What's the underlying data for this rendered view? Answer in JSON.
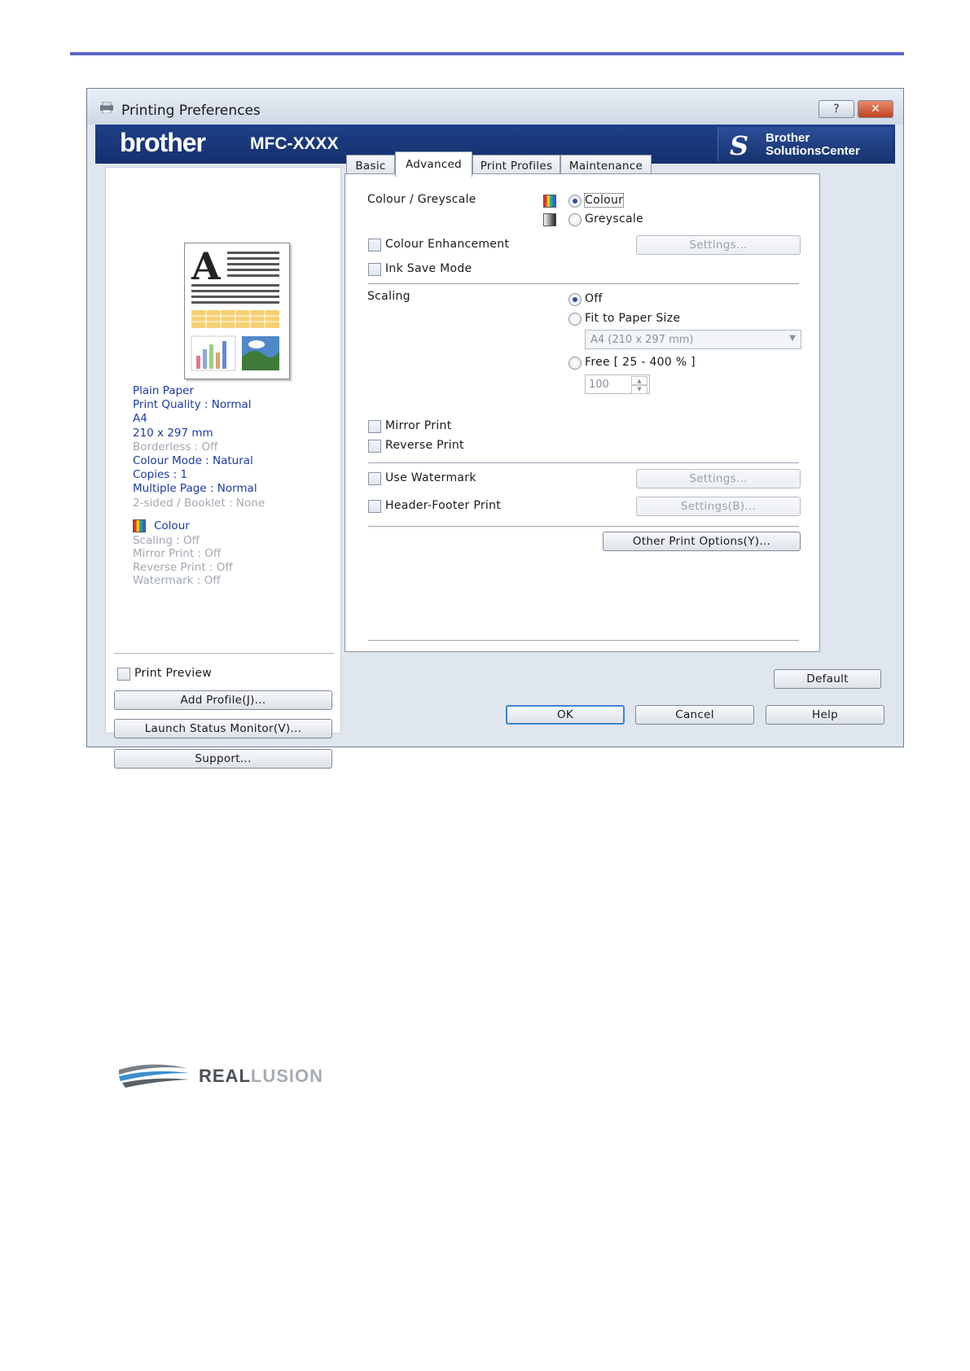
{
  "window": {
    "title": "Printing Preferences",
    "help_btn": "?",
    "close_btn": "✕"
  },
  "banner": {
    "brand": "brother",
    "model": "MFC-XXXX",
    "bsc_line1": "Brother",
    "bsc_line2": "SolutionsCenter"
  },
  "summary": {
    "items": [
      {
        "text": "Plain Paper",
        "enabled": true
      },
      {
        "text": "Print Quality : Normal",
        "enabled": true
      },
      {
        "text": "A4",
        "enabled": true
      },
      {
        "text": "210 x 297 mm",
        "enabled": true
      },
      {
        "text": "Borderless : Off",
        "enabled": false
      },
      {
        "text": "Colour Mode : Natural",
        "enabled": true
      },
      {
        "text": "Copies : 1",
        "enabled": true
      },
      {
        "text": "Multiple Page : Normal",
        "enabled": true
      },
      {
        "text": "2-sided / Booklet : None",
        "enabled": false
      }
    ],
    "colour_label": "Colour",
    "items2": [
      "Scaling : Off",
      "Mirror Print : Off",
      "Reverse Print : Off",
      "Watermark : Off"
    ]
  },
  "left": {
    "print_preview": "Print Preview",
    "add_profile": "Add Profile(J)...",
    "launch_status": "Launch Status Monitor(V)...",
    "support": "Support..."
  },
  "tabs": [
    "Basic",
    "Advanced",
    "Print Profiles",
    "Maintenance"
  ],
  "advanced": {
    "colour_greyscale_label": "Colour / Greyscale",
    "colour": "Colour",
    "greyscale": "Greyscale",
    "colour_enhancement": "Colour Enhancement",
    "ink_save": "Ink Save Mode",
    "settings": "Settings...",
    "scaling_label": "Scaling",
    "scaling_off": "Off",
    "fit_to_paper": "Fit to Paper Size",
    "paper_size_value": "A4 (210 x 297 mm)",
    "free": "Free [ 25 - 400 % ]",
    "free_value": "100",
    "mirror_print": "Mirror Print",
    "reverse_print": "Reverse Print",
    "use_watermark": "Use Watermark",
    "watermark_settings": "Settings...",
    "header_footer": "Header-Footer Print",
    "header_settings": "Settings(B)...",
    "other_options": "Other Print Options(Y)...",
    "default": "Default"
  },
  "footer": {
    "ok": "OK",
    "cancel": "Cancel",
    "help": "Help"
  },
  "logo": {
    "part1": "REAL",
    "part2": "LUSION"
  }
}
